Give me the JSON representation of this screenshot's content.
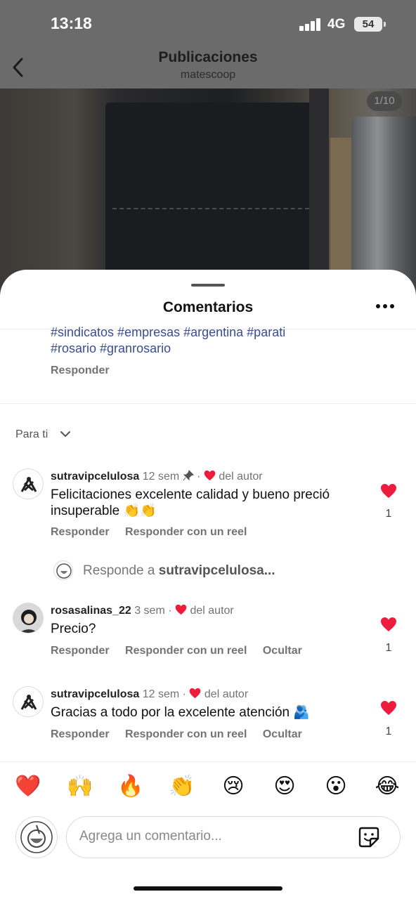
{
  "status": {
    "time": "13:18",
    "network": "4G",
    "battery": "54"
  },
  "nav": {
    "title": "Publicaciones",
    "subtitle": "matescoop",
    "counter": "1/10"
  },
  "sheet": {
    "title": "Comentarios"
  },
  "caption": {
    "hashtags_line1": "#sindicatos #empresas #argentina #parati",
    "hashtags_line2": "#rosario #granrosario",
    "reply": "Responder"
  },
  "filter": {
    "label": "Para ti"
  },
  "comments": [
    {
      "username": "sutravipcelulosa",
      "time": "12 sem",
      "by_author": "del autor",
      "text_line1": "Felicitaciones excelente calidad y bueno preció",
      "text_line2": "insuperable 👏👏",
      "likes": "1",
      "reply": "Responder",
      "reply_reel": "Responder con un reel"
    },
    {
      "username": "rosasalinas_22",
      "time": "3 sem",
      "by_author": "del autor",
      "text_line1": "Precio?",
      "likes": "1",
      "reply": "Responder",
      "reply_reel": "Responder con un reel",
      "hide": "Ocultar"
    },
    {
      "username": "sutravipcelulosa",
      "time": "12 sem",
      "by_author": "del autor",
      "text_line1": "Gracias a todo por la excelente atención 🫂",
      "likes": "1",
      "reply": "Responder",
      "reply_reel": "Responder con un reel",
      "hide": "Ocultar"
    }
  ],
  "reply_prompt": {
    "prefix": "Responde a",
    "username": "sutravipcelulosa..."
  },
  "emojis": [
    "❤️",
    "🙌",
    "🔥",
    "👏",
    "😢",
    "😍",
    "😮",
    "😂"
  ],
  "composer": {
    "placeholder": "Agrega un comentario..."
  },
  "colors": {
    "heart": "#ed1c3c",
    "hashtag": "#3a4d8f"
  }
}
